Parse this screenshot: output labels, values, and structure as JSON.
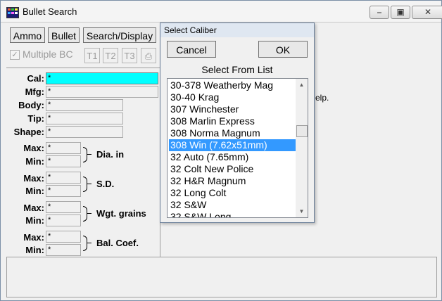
{
  "window": {
    "title": "Bullet Search"
  },
  "toolbar": {
    "ammo_label": "Ammo",
    "bullet_label": "Bullet",
    "search_display_label": "Search/Display",
    "multiple_bc_label": "Multiple BC",
    "multiple_bc_checked": true,
    "t1_label": "T1",
    "t2_label": "T2",
    "t3_label": "T3"
  },
  "fields": {
    "cal": {
      "label": "Cal:",
      "value": "*"
    },
    "mfg": {
      "label": "Mfg:",
      "value": "*"
    },
    "body": {
      "label": "Body:",
      "value": "*"
    },
    "tip": {
      "label": "Tip:",
      "value": "*"
    },
    "shape": {
      "label": "Shape:",
      "value": "*"
    }
  },
  "ranges": {
    "max_label": "Max:",
    "min_label": "Min:",
    "dia": {
      "label": "Dia.  in",
      "max": "*",
      "min": "*"
    },
    "sd": {
      "label": "S.D.",
      "max": "*",
      "min": "*"
    },
    "wgt": {
      "label": "Wgt.  grains",
      "max": "*",
      "min": "*"
    },
    "bc": {
      "label": "Bal. Coef.",
      "max": "*",
      "min": "*"
    }
  },
  "help_text_partial": "elp.",
  "dialog": {
    "title": "Select Caliber",
    "cancel_label": "Cancel",
    "ok_label": "OK",
    "subtitle": "Select From List",
    "items": [
      "30-378 Weatherby Mag",
      "30-40 Krag",
      "307 Winchester",
      "308 Marlin Express",
      "308 Norma Magnum",
      "308 Win (7.62x51mm)",
      "32 Auto (7.65mm)",
      "32 Colt New Police",
      "32 H&R Magnum",
      "32 Long Colt",
      "32 S&W",
      "32 S&W Long"
    ],
    "selected_item": "308 Win (7.62x51mm)"
  },
  "colors": {
    "highlight_field": "#00ffff",
    "selection": "#3399ff"
  }
}
